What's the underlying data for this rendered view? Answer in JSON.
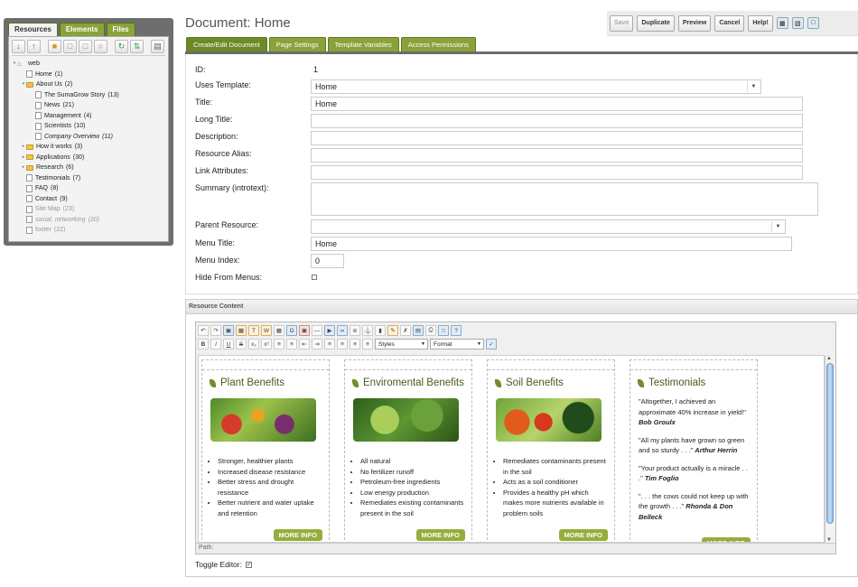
{
  "sidebar": {
    "tabs": [
      "Resources",
      "Elements",
      "Files"
    ],
    "toolbar_icons": [
      "arrow-down-icon",
      "arrow-up-icon",
      "new-folder-icon",
      "new-document-icon",
      "new-weblink-icon",
      "new-symlink-icon",
      "refresh-icon",
      "sort-icon",
      "trash-icon"
    ],
    "tree": [
      {
        "label": "web",
        "level": 0,
        "type": "home",
        "toggle": "▾"
      },
      {
        "label": "Home",
        "count": "(1)",
        "level": 1,
        "type": "doc"
      },
      {
        "label": "About Us",
        "count": "(2)",
        "level": 1,
        "type": "folder",
        "toggle": "▾"
      },
      {
        "label": "The SumaGrow Story",
        "count": "(13)",
        "level": 2,
        "type": "doc"
      },
      {
        "label": "News",
        "count": "(21)",
        "level": 2,
        "type": "doc"
      },
      {
        "label": "Management",
        "count": "(4)",
        "level": 2,
        "type": "doc"
      },
      {
        "label": "Scientists",
        "count": "(10)",
        "level": 2,
        "type": "doc"
      },
      {
        "label": "Company Overview",
        "count": "(11)",
        "level": 2,
        "type": "doc",
        "style": "italic"
      },
      {
        "label": "How it works",
        "count": "(3)",
        "level": 1,
        "type": "folder",
        "toggle": "▸"
      },
      {
        "label": "Applications",
        "count": "(30)",
        "level": 1,
        "type": "folder",
        "toggle": "▸"
      },
      {
        "label": "Research",
        "count": "(6)",
        "level": 1,
        "type": "folder",
        "toggle": "▸"
      },
      {
        "label": "Testimonials",
        "count": "(7)",
        "level": 1,
        "type": "doc"
      },
      {
        "label": "FAQ",
        "count": "(8)",
        "level": 1,
        "type": "doc"
      },
      {
        "label": "Contact",
        "count": "(9)",
        "level": 1,
        "type": "doc"
      },
      {
        "label": "Site Map",
        "count": "(23)",
        "level": 1,
        "type": "doc",
        "style": "grey"
      },
      {
        "label": "social_networking",
        "count": "(20)",
        "level": 1,
        "type": "doc",
        "style": "grey italic"
      },
      {
        "label": "footer",
        "count": "(22)",
        "level": 1,
        "type": "doc",
        "style": "grey"
      }
    ]
  },
  "header": {
    "title": "Document: Home",
    "buttons": {
      "save": "Save",
      "duplicate": "Duplicate",
      "preview": "Preview",
      "cancel": "Cancel",
      "help": "Help!"
    }
  },
  "tabs": [
    "Create/Edit Document",
    "Page Settings",
    "Template Variables",
    "Access Permissions"
  ],
  "form": {
    "id_label": "ID:",
    "id_value": "1",
    "template_label": "Uses Template:",
    "template_value": "Home",
    "title_label": "Title:",
    "title_value": "Home",
    "longtitle_label": "Long Title:",
    "description_label": "Description:",
    "alias_label": "Resource Alias:",
    "link_label": "Link Attributes:",
    "summary_label": "Summary (introtext):",
    "parent_label": "Parent Resource:",
    "menutitle_label": "Menu Title:",
    "menutitle_value": "Home",
    "menuindex_label": "Menu Index:",
    "menuindex_value": "0",
    "hide_label": "Hide From Menus:"
  },
  "content": {
    "header": "Resource Content",
    "styles_select": "Styles",
    "format_select": "Format",
    "path_label": "Path:",
    "toggle_label": "Toggle Editor:",
    "columns": [
      {
        "title": "Plant Benefits",
        "bullets": [
          "Stronger, healthier plants",
          "Increased disease resistance",
          "Better stress and drought resistance",
          "Better nutrient and water uptake and retention"
        ],
        "more": "MORE INFO"
      },
      {
        "title": "Enviromental Benefits",
        "bullets": [
          "All natural",
          "No fertilizer runoff",
          "Petroleum-free ingredients",
          "Low energy production",
          "Remediates existing contaminants present in the soil"
        ],
        "more": "MORE INFO"
      },
      {
        "title": "Soil Benefits",
        "bullets": [
          "Remediates contaminants present in the soil",
          "Acts as a soil conditioner",
          "Provides a healthy pH which makes more nutrients available in problem soils"
        ],
        "more": "MORE INFO"
      },
      {
        "title": "Testimonials",
        "quotes": [
          {
            "text": "\"Altogether, I achieved an approximate 40% increase in yield!\"",
            "author": "Bob Groulx"
          },
          {
            "text": "\"All my plants have grown so green and so sturdy . . .\"",
            "author": "Arthur Herrin"
          },
          {
            "text": "\"Your product actually is a miracle . . .\"",
            "author": "Tim Foglio"
          },
          {
            "text": "\". . . the cows could not keep up with the growth . . .\"",
            "author": "Rhonda & Don Belleck"
          }
        ],
        "more": "MORE INFO"
      }
    ]
  }
}
